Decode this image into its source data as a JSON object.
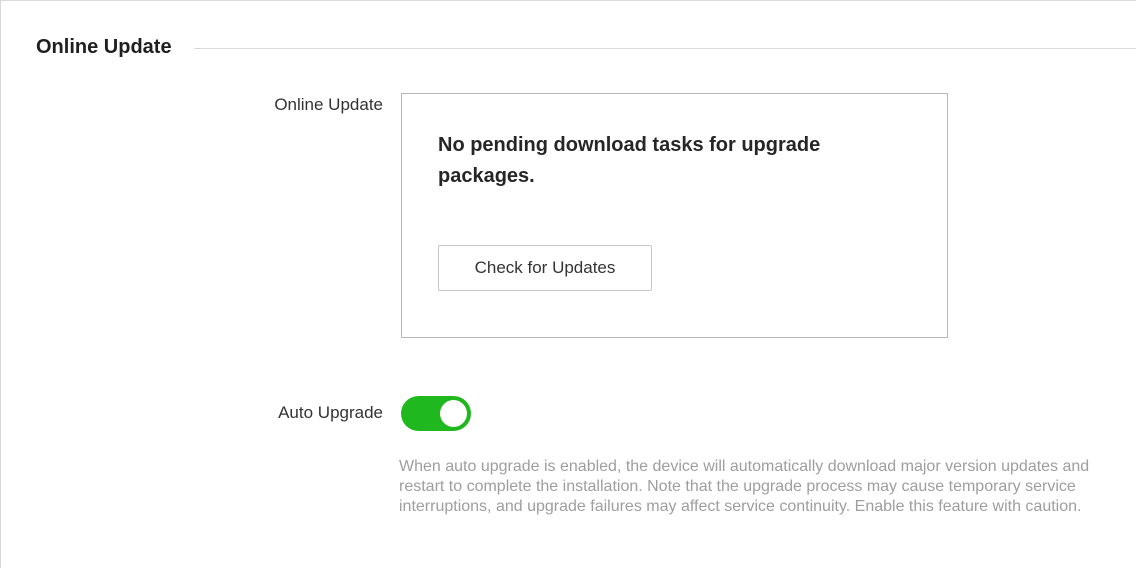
{
  "section": {
    "title": "Online Update"
  },
  "online_update": {
    "label": "Online Update",
    "status_message": "No pending download tasks for upgrade packages.",
    "check_button_label": "Check for Updates"
  },
  "auto_upgrade": {
    "label": "Auto Upgrade",
    "enabled": true,
    "toggle_color": "#1fb81f",
    "description": "When auto upgrade is enabled, the device will automatically download major version updates and restart to complete the installation. Note that the upgrade process may cause temporary service interruptions, and upgrade failures may affect service continuity. Enable this feature with caution."
  }
}
